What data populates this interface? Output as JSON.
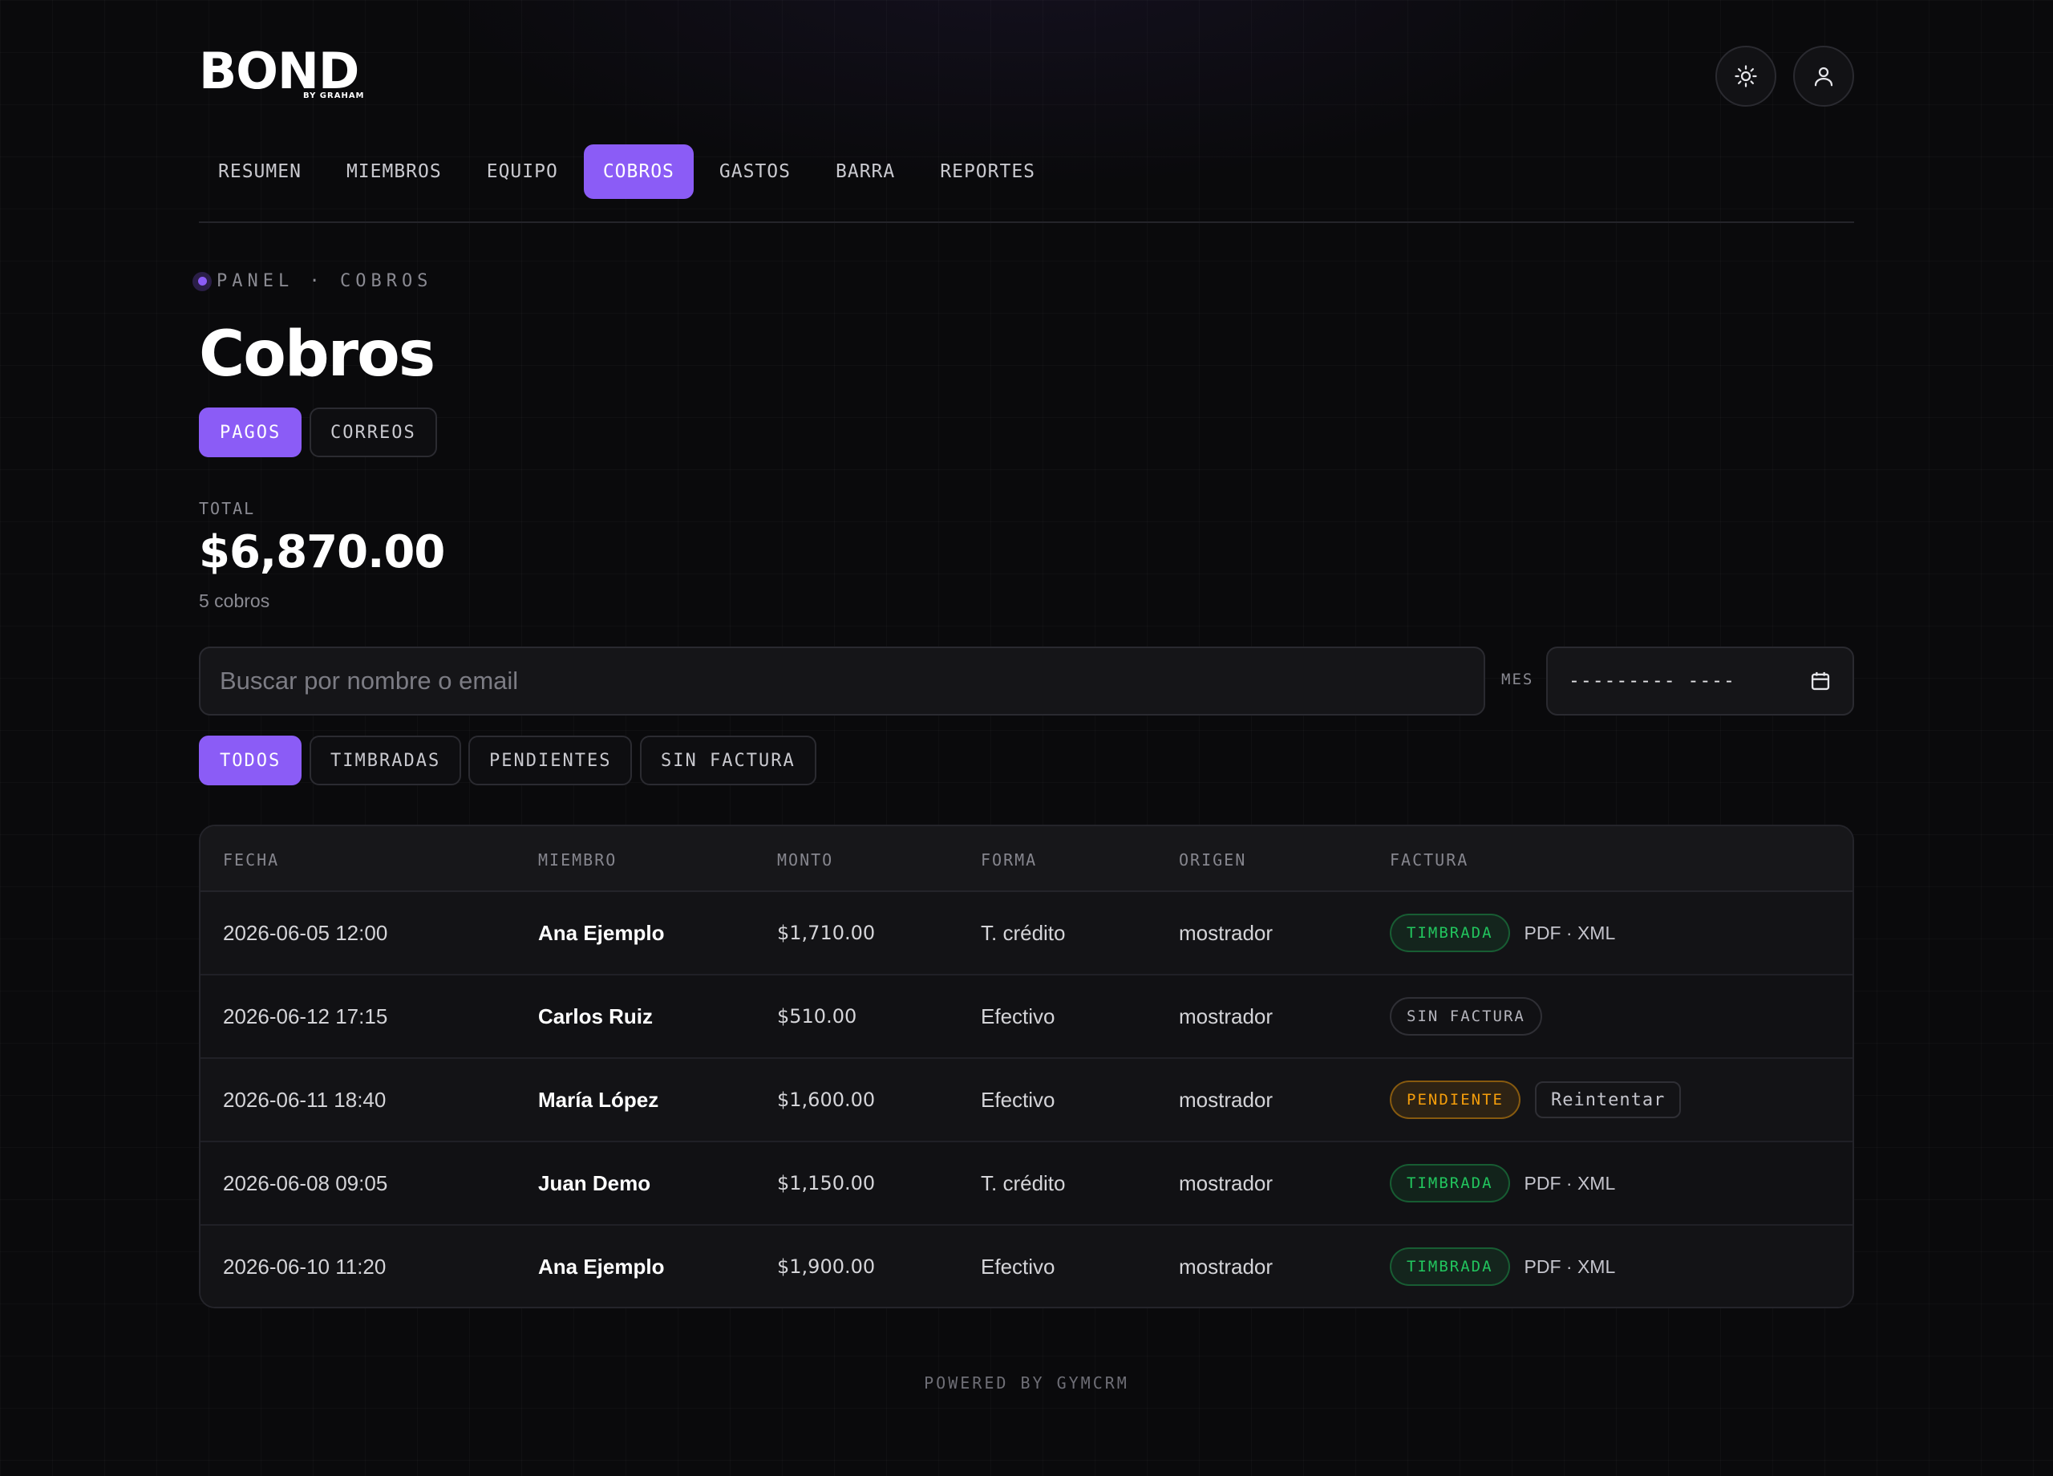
{
  "brand": {
    "logo_text": "BOND",
    "logo_sub": "BY GRAHAM"
  },
  "header": {
    "theme_icon": "sun-icon",
    "user_icon": "user-icon"
  },
  "nav": {
    "items": [
      {
        "label": "RESUMEN"
      },
      {
        "label": "MIEMBROS"
      },
      {
        "label": "EQUIPO"
      },
      {
        "label": "COBROS",
        "active": true
      },
      {
        "label": "GASTOS"
      },
      {
        "label": "BARRA"
      },
      {
        "label": "REPORTES"
      }
    ]
  },
  "breadcrumb": {
    "text": "PANEL · COBROS"
  },
  "page": {
    "title": "Cobros"
  },
  "view_tabs": [
    {
      "label": "PAGOS",
      "active": true
    },
    {
      "label": "CORREOS"
    }
  ],
  "summary": {
    "total_label": "TOTAL",
    "total_value": "$6,870.00",
    "count_text": "5 cobros"
  },
  "search": {
    "placeholder": "Buscar por nombre o email",
    "value": ""
  },
  "month": {
    "label": "MES",
    "value": "--------- ----",
    "icon": "calendar-icon"
  },
  "filters": [
    {
      "label": "TODOS",
      "active": true
    },
    {
      "label": "TIMBRADAS"
    },
    {
      "label": "PENDIENTES"
    },
    {
      "label": "SIN FACTURA"
    }
  ],
  "table": {
    "columns": [
      "FECHA",
      "MIEMBRO",
      "MONTO",
      "FORMA",
      "ORIGEN",
      "FACTURA"
    ],
    "rows": [
      {
        "fecha": "2026-06-05 12:00",
        "miembro": "Ana Ejemplo",
        "monto": "$1,710.00",
        "forma": "T. crédito",
        "origen": "mostrador",
        "factura": "TIMBRADA",
        "status": "timbrada",
        "extra": "PDF · XML"
      },
      {
        "fecha": "2026-06-12 17:15",
        "miembro": "Carlos Ruiz",
        "monto": "$510.00",
        "forma": "Efectivo",
        "origen": "mostrador",
        "factura": "SIN FACTURA",
        "status": "sin",
        "extra": ""
      },
      {
        "fecha": "2026-06-11 18:40",
        "miembro": "María López",
        "monto": "$1,600.00",
        "forma": "Efectivo",
        "origen": "mostrador",
        "factura": "PENDIENTE",
        "status": "pend",
        "extra": "Reintentar"
      },
      {
        "fecha": "2026-06-08 09:05",
        "miembro": "Juan Demo",
        "monto": "$1,150.00",
        "forma": "T. crédito",
        "origen": "mostrador",
        "factura": "TIMBRADA",
        "status": "timbrada",
        "extra": "PDF · XML"
      },
      {
        "fecha": "2026-06-10 11:20",
        "miembro": "Ana Ejemplo",
        "monto": "$1,900.00",
        "forma": "Efectivo",
        "origen": "mostrador",
        "factura": "TIMBRADA",
        "status": "timbrada",
        "extra": "PDF · XML"
      }
    ]
  },
  "footer": {
    "text": "POWERED BY GYMCRM"
  },
  "colors": {
    "accent": "#8b5cf6",
    "success": "#22c55e",
    "warning": "#f59e0b",
    "background": "#0a0a0c"
  }
}
